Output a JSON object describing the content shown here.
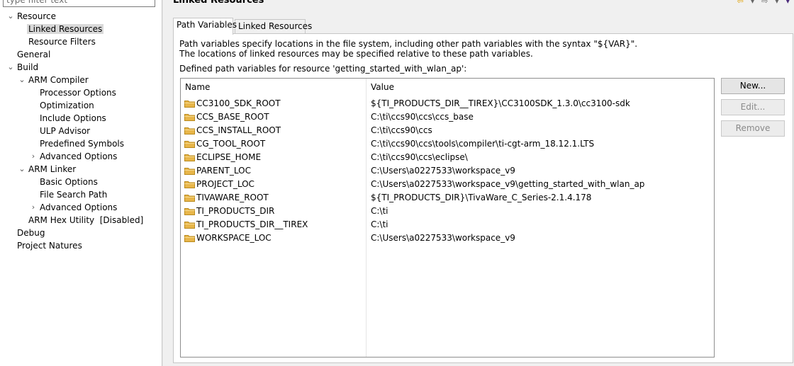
{
  "filter": {
    "placeholder": "type filter text"
  },
  "tree": {
    "items": [
      {
        "label": "Resource",
        "twisty": "⌄"
      },
      {
        "label": "Linked Resources",
        "twisty": ""
      },
      {
        "label": "Resource Filters",
        "twisty": ""
      },
      {
        "label": "General",
        "twisty": ""
      },
      {
        "label": "Build",
        "twisty": "⌄"
      },
      {
        "label": "ARM Compiler",
        "twisty": "⌄"
      },
      {
        "label": "Processor Options",
        "twisty": ""
      },
      {
        "label": "Optimization",
        "twisty": ""
      },
      {
        "label": "Include Options",
        "twisty": ""
      },
      {
        "label": "ULP Advisor",
        "twisty": ""
      },
      {
        "label": "Predefined Symbols",
        "twisty": ""
      },
      {
        "label": "Advanced Options",
        "twisty": "›"
      },
      {
        "label": "ARM Linker",
        "twisty": "⌄"
      },
      {
        "label": "Basic Options",
        "twisty": ""
      },
      {
        "label": "File Search Path",
        "twisty": ""
      },
      {
        "label": "Advanced Options",
        "twisty": "›"
      },
      {
        "label": "ARM Hex Utility  [Disabled]",
        "twisty": ""
      },
      {
        "label": "Debug",
        "twisty": ""
      },
      {
        "label": "Project Natures",
        "twisty": ""
      }
    ]
  },
  "page": {
    "title": "Linked Resources"
  },
  "tabs": [
    {
      "label": "Path Variables"
    },
    {
      "label": "Linked Resources"
    }
  ],
  "description": {
    "line1": "Path variables specify locations in the file system, including other path variables with the syntax \"${VAR}\".",
    "line2": "The locations of linked resources may be specified relative to these path variables.",
    "defined": "Defined path variables for resource 'getting_started_with_wlan_ap':"
  },
  "table": {
    "headers": {
      "name": "Name",
      "value": "Value"
    },
    "rows": [
      {
        "name": "CC3100_SDK_ROOT",
        "value": "${TI_PRODUCTS_DIR__TIREX}\\CC3100SDK_1.3.0\\cc3100-sdk"
      },
      {
        "name": "CCS_BASE_ROOT",
        "value": "C:\\ti\\ccs90\\ccs\\ccs_base"
      },
      {
        "name": "CCS_INSTALL_ROOT",
        "value": "C:\\ti\\ccs90\\ccs"
      },
      {
        "name": "CG_TOOL_ROOT",
        "value": "C:\\ti\\ccs90\\ccs\\tools\\compiler\\ti-cgt-arm_18.12.1.LTS"
      },
      {
        "name": "ECLIPSE_HOME",
        "value": "C:\\ti\\ccs90\\ccs\\eclipse\\"
      },
      {
        "name": "PARENT_LOC",
        "value": "C:\\Users\\a0227533\\workspace_v9"
      },
      {
        "name": "PROJECT_LOC",
        "value": "C:\\Users\\a0227533\\workspace_v9\\getting_started_with_wlan_ap"
      },
      {
        "name": "TIVAWARE_ROOT",
        "value": "${TI_PRODUCTS_DIR}\\TivaWare_C_Series-2.1.4.178"
      },
      {
        "name": "TI_PRODUCTS_DIR",
        "value": "C:\\ti"
      },
      {
        "name": "TI_PRODUCTS_DIR__TIREX",
        "value": "C:\\ti"
      },
      {
        "name": "WORKSPACE_LOC",
        "value": "C:\\Users\\a0227533\\workspace_v9"
      }
    ]
  },
  "buttons": {
    "new": "New...",
    "edit": "Edit...",
    "remove": "Remove"
  },
  "colors": {
    "folder": "#e8b64a",
    "selection": "#d9d9d9"
  }
}
